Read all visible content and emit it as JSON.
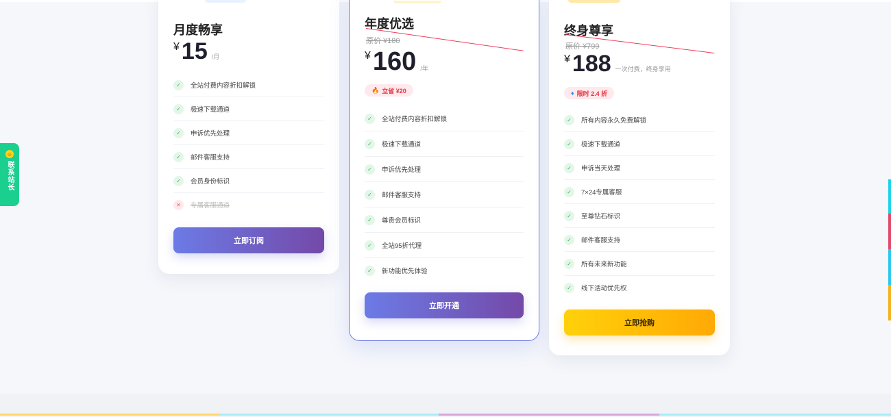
{
  "contact": {
    "icon": "smiley-icon",
    "label": "联系站长"
  },
  "plans": {
    "monthly": {
      "title": "月度畅享",
      "currency": "¥",
      "price": "15",
      "unit": "/月",
      "features": [
        {
          "text": "全站付费内容折扣解锁",
          "enabled": true
        },
        {
          "text": "极速下载通道",
          "enabled": true
        },
        {
          "text": "申诉优先处理",
          "enabled": true
        },
        {
          "text": "邮件客服支持",
          "enabled": true
        },
        {
          "text": "会员身份标识",
          "enabled": true
        },
        {
          "text": "专属客服通道",
          "enabled": false
        }
      ],
      "button": "立即订阅"
    },
    "yearly": {
      "title": "年度优选",
      "original_price": "原价 ¥180",
      "currency": "¥",
      "price": "160",
      "unit": "/年",
      "badge": "立省 ¥20",
      "badge_icon": "fire-icon",
      "features": [
        {
          "text": "全站付费内容折扣解锁",
          "enabled": true
        },
        {
          "text": "极速下载通道",
          "enabled": true
        },
        {
          "text": "申诉优先处理",
          "enabled": true
        },
        {
          "text": "邮件客服支持",
          "enabled": true
        },
        {
          "text": "尊贵会员标识",
          "enabled": true
        },
        {
          "text": "全站95折代理",
          "enabled": true
        },
        {
          "text": "新功能优先体验",
          "enabled": true
        }
      ],
      "button": "立即开通"
    },
    "lifetime": {
      "title": "终身尊享",
      "original_price": "原价 ¥799",
      "currency": "¥",
      "price": "188",
      "unit": "一次付费，终身享用",
      "badge": "限时 2.4 折",
      "badge_icon": "diamond-icon",
      "features": [
        {
          "text": "所有内容永久免费解锁",
          "enabled": true
        },
        {
          "text": "极速下载通道",
          "enabled": true
        },
        {
          "text": "申诉当天处理",
          "enabled": true
        },
        {
          "text": "7×24专属客服",
          "enabled": true
        },
        {
          "text": "至尊钻石标识",
          "enabled": true
        },
        {
          "text": "邮件客服支持",
          "enabled": true
        },
        {
          "text": "所有未来新功能",
          "enabled": true
        },
        {
          "text": "线下活动优先权",
          "enabled": true
        }
      ],
      "button": "立即抢购"
    }
  },
  "colors": {
    "accent_purple_start": "#6c7be6",
    "accent_purple_end": "#7449a8",
    "gold_start": "#ffd10a",
    "gold_end": "#ffa905",
    "contact_green": "#1bcf8f",
    "check_green": "#36b35a",
    "badge_red": "#e5323f"
  }
}
